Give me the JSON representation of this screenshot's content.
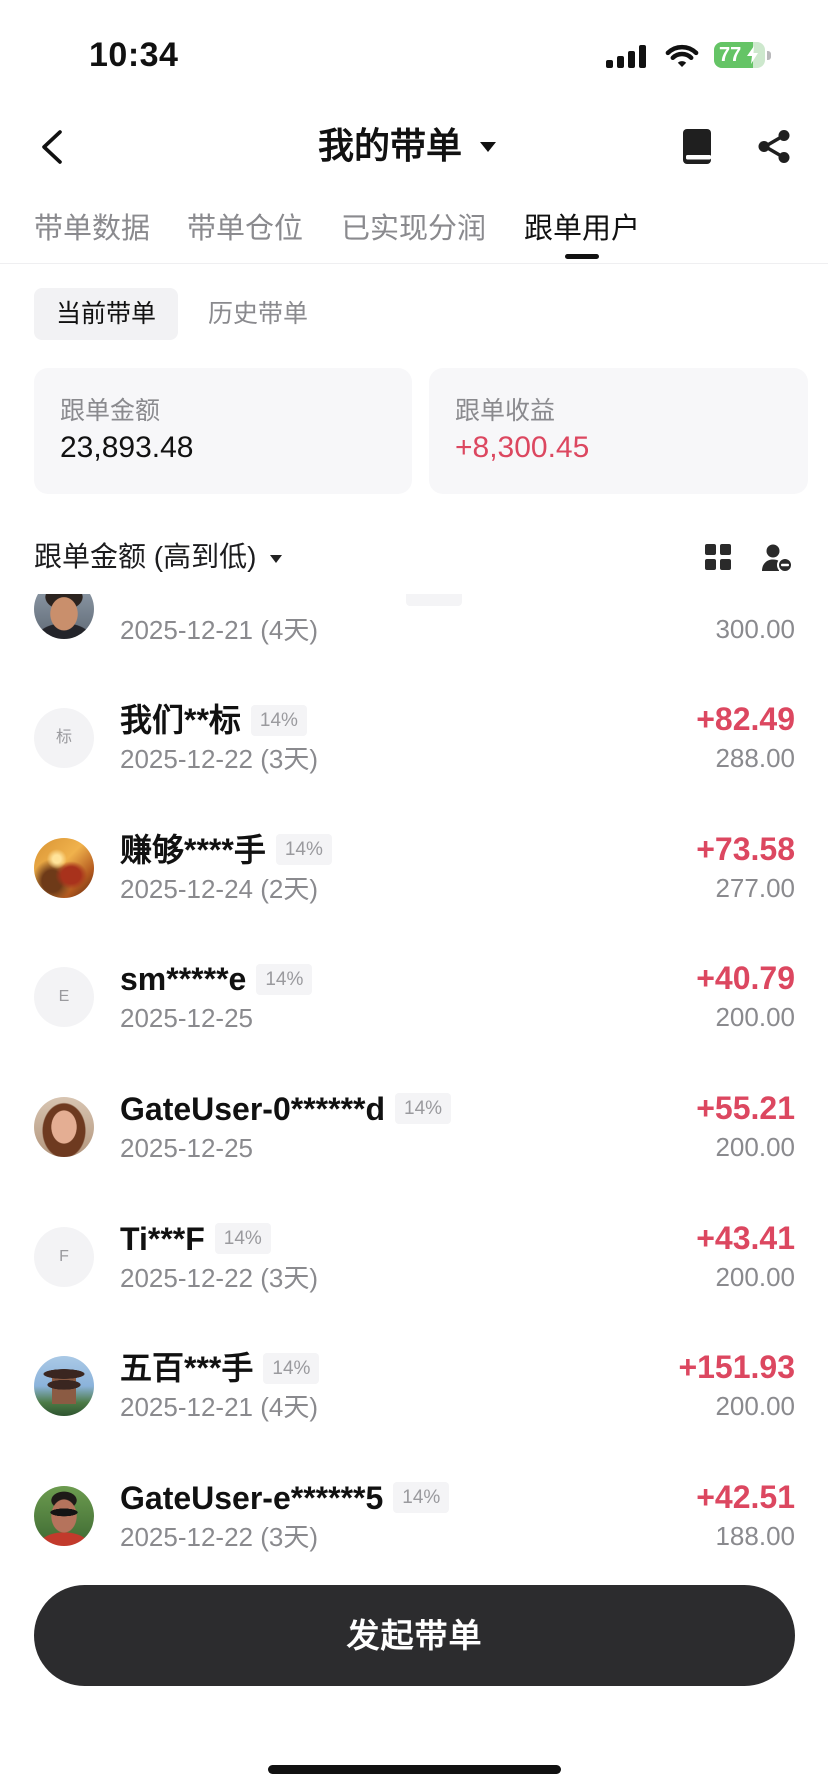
{
  "status_bar": {
    "time": "10:34",
    "battery": "77"
  },
  "header": {
    "title": "我的带单"
  },
  "icons": {
    "back": "chevron-left-icon",
    "title_caret": "caret-down-icon",
    "book": "book-icon",
    "share": "share-icon",
    "sort_caret": "caret-down-icon",
    "grid_view": "grid-view-icon",
    "user_remove": "user-remove-icon",
    "signal": "cellular-signal-icon",
    "wifi": "wifi-icon",
    "battery": "battery-charging-icon"
  },
  "tabs": [
    {
      "label": "带单数据"
    },
    {
      "label": "带单仓位"
    },
    {
      "label": "已实现分润"
    },
    {
      "label": "跟单用户",
      "active": true
    }
  ],
  "sub_tabs": [
    {
      "label": "当前带单",
      "active": true
    },
    {
      "label": "历史带单"
    }
  ],
  "summary": [
    {
      "label": "跟单金额",
      "value": "23,893.48"
    },
    {
      "label": "跟单收益",
      "value": "+8,300.45"
    }
  ],
  "sort": {
    "label": "跟单金额 (高到低)"
  },
  "followers": [
    {
      "date": "2025-12-21 (4天)",
      "amount": "300.00"
    },
    {
      "avatar_letter": "标",
      "name": "我们**标",
      "share": "14%",
      "date": "2025-12-22 (3天)",
      "profit": "+82.49",
      "amount": "288.00"
    },
    {
      "name": "赚够****手",
      "share": "14%",
      "date": "2025-12-24 (2天)",
      "profit": "+73.58",
      "amount": "277.00"
    },
    {
      "avatar_letter": "E",
      "name": "sm*****e",
      "share": "14%",
      "date": "2025-12-25",
      "profit": "+40.79",
      "amount": "200.00"
    },
    {
      "name": "GateUser-0******d",
      "share": "14%",
      "date": "2025-12-25",
      "profit": "+55.21",
      "amount": "200.00"
    },
    {
      "avatar_letter": "F",
      "name": "Ti***F",
      "share": "14%",
      "date": "2025-12-22 (3天)",
      "profit": "+43.41",
      "amount": "200.00"
    },
    {
      "name": "五百***手",
      "share": "14%",
      "date": "2025-12-21 (4天)",
      "profit": "+151.93",
      "amount": "200.00"
    },
    {
      "name": "GateUser-e******5",
      "share": "14%",
      "date": "2025-12-22 (3天)",
      "profit": "+42.51",
      "amount": "188.00"
    }
  ],
  "footer": {
    "button_label": "发起带单"
  },
  "colors": {
    "profit": "#dc4760",
    "primary_button": "#2c2c2e",
    "battery_charging": "#65c466"
  }
}
